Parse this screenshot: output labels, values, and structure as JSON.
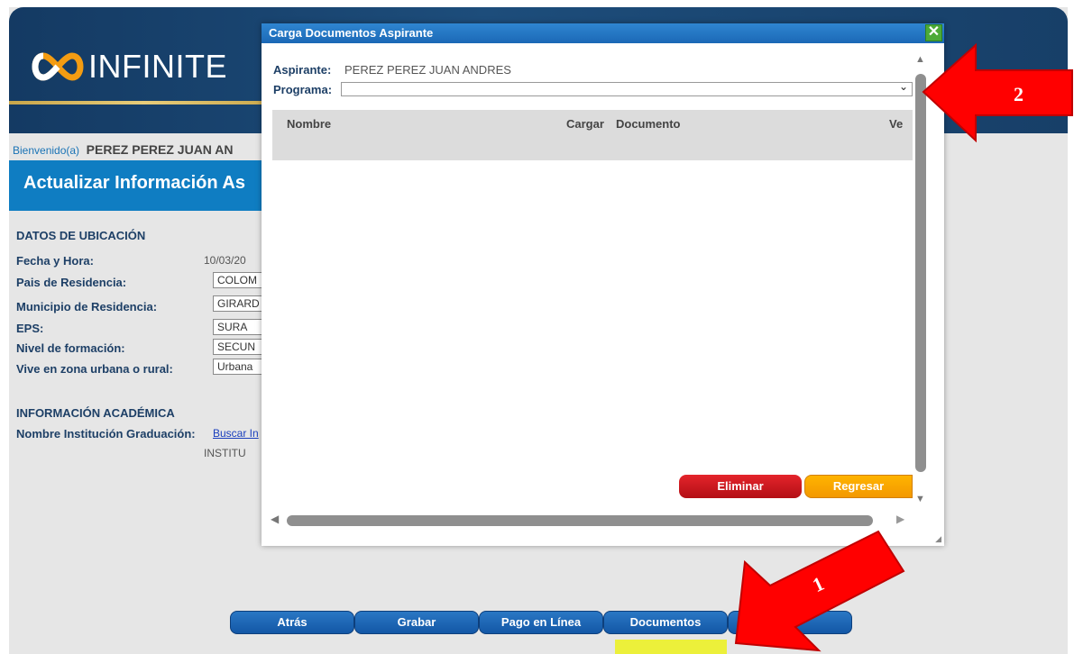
{
  "app": {
    "logo_text": "INFINITE"
  },
  "welcome": {
    "label": "Bienvenido(a)",
    "name": "PEREZ PEREZ JUAN AN"
  },
  "page_title": "Actualizar Información As",
  "location": {
    "heading": "DATOS DE UBICACIÓN",
    "fields": [
      {
        "label": "Fecha y Hora:",
        "value": "10/03/20"
      },
      {
        "label": "Pais de Residencia:",
        "value": "COLOM"
      },
      {
        "label": "Municipio de Residencia:",
        "value": "GIRARD"
      },
      {
        "label": "EPS:",
        "value": "SURA"
      },
      {
        "label": "Nivel de formación:",
        "value": "SECUN"
      },
      {
        "label": "Vive en zona urbana o rural:",
        "value": "Urbana"
      }
    ]
  },
  "academic": {
    "heading": "INFORMACIÓN ACADÉMICA",
    "institution_label": "Nombre Institución Graduación:",
    "institution_link": "Buscar In",
    "institution_value": "INSTITU"
  },
  "bottom_buttons": [
    "Atrás",
    "Grabar",
    "Pago en Línea",
    "Documentos"
  ],
  "modal": {
    "title": "Carga Documentos Aspirante",
    "close_label": "✕",
    "aspirante_label": "Aspirante:",
    "aspirante_value": "PEREZ PEREZ JUAN ANDRES",
    "programa_label": "Programa:",
    "programa_value": "",
    "table_headers": [
      "Nombre",
      "Cargar",
      "Documento",
      "Ve"
    ],
    "delete_label": "Eliminar",
    "back_label": "Regresar"
  },
  "annotations": [
    {
      "number": "1",
      "color": "#ff0000"
    },
    {
      "number": "2",
      "color": "#ff0000"
    }
  ],
  "colors": {
    "banner": "#1d4d7b",
    "titlebar": "#0f7dc2",
    "modal_header": "#1b68b6",
    "delete": "#d81e25",
    "back": "#f5a000",
    "highlight": "#ecf03a",
    "arrow": "#ff0000"
  }
}
